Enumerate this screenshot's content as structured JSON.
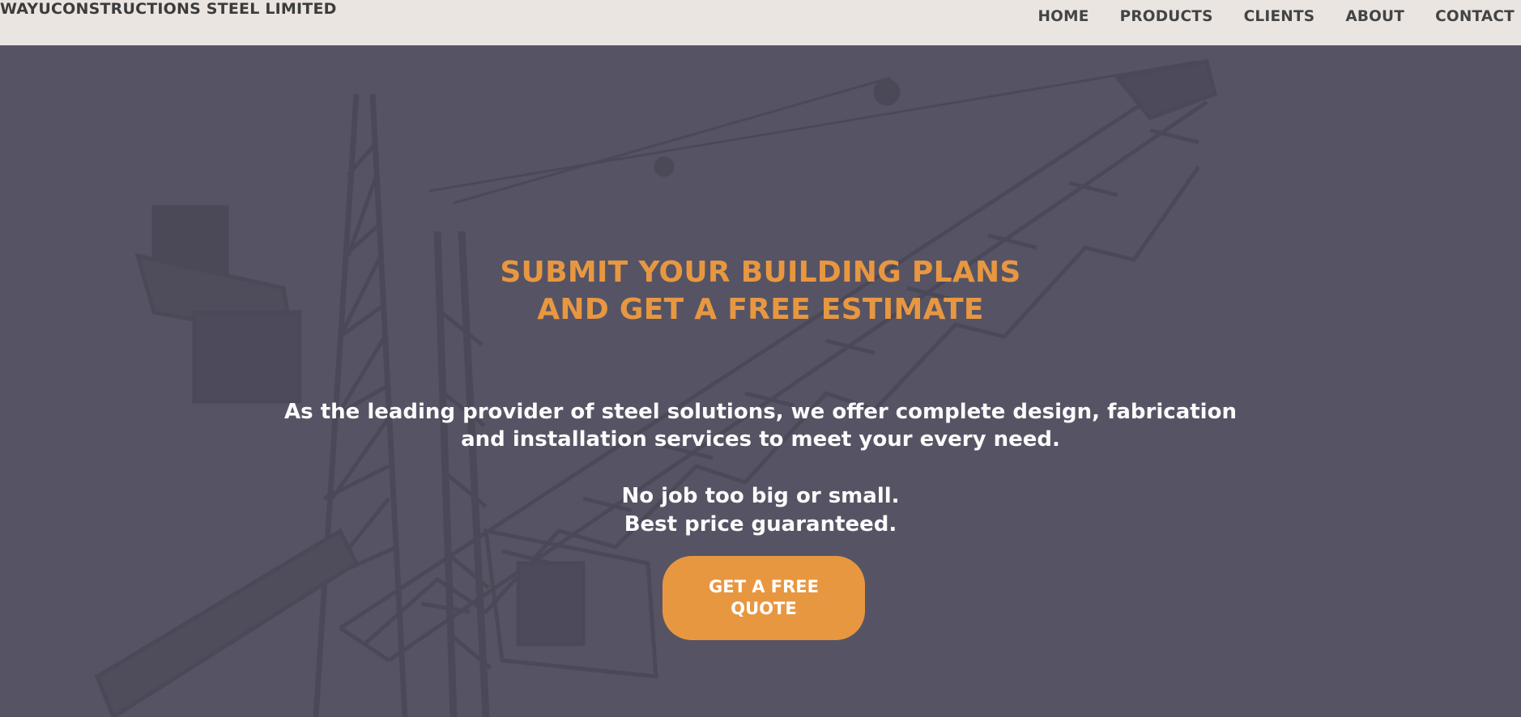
{
  "header": {
    "brand": "WAYUCONSTRUCTIONS STEEL LIMITED",
    "nav": [
      "HOME",
      "PRODUCTS",
      "CLIENTS",
      "ABOUT",
      "CONTACT"
    ]
  },
  "hero": {
    "headline_line1": "SUBMIT YOUR BUILDING PLANS",
    "headline_line2": "AND GET A FREE ESTIMATE",
    "lead_line1": "As the leading provider of steel solutions, we offer complete design, fabrication",
    "lead_line2": "and installation services to meet your every need.",
    "tagline_line1": "No job too big or small.",
    "tagline_line2": "Best price guaranteed.",
    "cta_line1": "GET A FREE",
    "cta_line2": "QUOTE",
    "background_image": "construction-crane"
  },
  "colors": {
    "accent": "#e89741",
    "header_bg": "#ebe5e2",
    "overlay": "#565564",
    "text_light": "#fbfbfb"
  }
}
